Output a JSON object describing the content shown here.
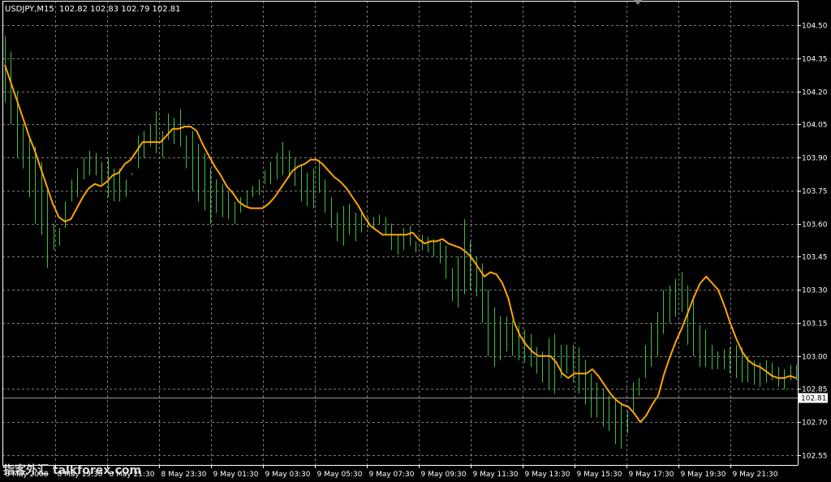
{
  "header": {
    "symbol": "USDJPY,M15",
    "ohlc": "102.82 102.83 102.79 102.81"
  },
  "colors": {
    "background": "#000000",
    "grid": "#7a7a7a",
    "bars": "#3fbf3f",
    "ma": "#ffa500",
    "axis_text": "#ffffff",
    "current_price_line": "#9a9a9a",
    "current_price_label_bg": "#ffffff"
  },
  "watermark": {
    "text": "指客外汇 talkforex.com"
  },
  "current_price": {
    "label": "102.81",
    "value": 102.81
  },
  "chart_data": {
    "type": "line",
    "title": "",
    "xlabel": "",
    "ylabel": "",
    "ylim": [
      102.47,
      104.58
    ],
    "grid": true,
    "y_ticks": [
      104.5,
      104.35,
      104.2,
      104.05,
      103.9,
      103.75,
      103.6,
      103.45,
      103.3,
      103.15,
      103.0,
      102.85,
      102.7,
      102.55
    ],
    "y_tick_labels": [
      "104.50",
      "104.35",
      "104.20",
      "104.05",
      "103.90",
      "103.75",
      "103.60",
      "103.45",
      "103.30",
      "103.15",
      "103.00",
      "102.85",
      "102.70",
      "102.55"
    ],
    "x_tick_labels": [
      "8 May 2008",
      "8 May 19:30",
      "8 May 21:30",
      "8 May 23:30",
      "9 May 01:30",
      "9 May 03:30",
      "9 May 05:30",
      "9 May 07:30",
      "9 May 09:30",
      "9 May 11:30",
      "9 May 13:30",
      "9 May 15:30",
      "9 May 17:30",
      "9 May 19:30",
      "9 May 21:30"
    ],
    "bars": {
      "name": "",
      "high": [
        104.45,
        104.38,
        104.2,
        104.05,
        104.0,
        103.95,
        103.88,
        103.75,
        103.6,
        103.58,
        103.7,
        103.8,
        103.85,
        103.9,
        103.93,
        103.92,
        103.88,
        103.9,
        103.85,
        103.85,
        103.8,
        103.83,
        104.0,
        104.02,
        104.05,
        104.11,
        104.02,
        104.1,
        104.08,
        104.12,
        104.0,
        104.02,
        103.96,
        103.92,
        103.85,
        103.8,
        103.78,
        103.75,
        103.7,
        103.72,
        103.75,
        103.77,
        103.8,
        103.84,
        103.88,
        103.92,
        103.97,
        103.93,
        103.9,
        103.87,
        103.83,
        103.85,
        103.89,
        103.8,
        103.72,
        103.65,
        103.68,
        103.69,
        103.65,
        103.65,
        103.63,
        103.63,
        103.64,
        103.63,
        103.6,
        103.55,
        103.58,
        103.59,
        103.52,
        103.55,
        103.54,
        103.53,
        103.52,
        103.5,
        103.4,
        103.45,
        103.62,
        103.52,
        103.45,
        103.42,
        103.3,
        103.22,
        103.18,
        103.18,
        103.16,
        103.14,
        103.12,
        103.1,
        103.04,
        103.02,
        103.08,
        103.1,
        103.05,
        103.05,
        103.05,
        103.04,
        102.98,
        102.92,
        102.88,
        102.85,
        102.82,
        102.8,
        102.78,
        102.75,
        102.88,
        102.9,
        103.05,
        103.15,
        103.2,
        103.3,
        103.32,
        103.35,
        103.38,
        103.32,
        103.25,
        103.14,
        103.12,
        103.05,
        103.02,
        103.03,
        103.04,
        103.05,
        103.04,
        103.0,
        102.98,
        102.97,
        102.98,
        102.97,
        102.95,
        102.94,
        102.96,
        102.96
      ],
      "low": [
        104.15,
        104.05,
        103.9,
        103.85,
        103.72,
        103.6,
        103.55,
        103.4,
        103.48,
        103.5,
        103.58,
        103.7,
        103.72,
        103.8,
        103.82,
        103.82,
        103.78,
        103.72,
        103.7,
        103.7,
        103.72,
        103.82,
        103.85,
        103.9,
        103.95,
        103.92,
        103.9,
        103.98,
        103.96,
        103.95,
        103.85,
        103.75,
        103.7,
        103.66,
        103.6,
        103.65,
        103.63,
        103.62,
        103.6,
        103.65,
        103.68,
        103.72,
        103.73,
        103.78,
        103.78,
        103.8,
        103.82,
        103.81,
        103.77,
        103.7,
        103.68,
        103.67,
        103.74,
        103.65,
        103.58,
        103.52,
        103.5,
        103.55,
        103.52,
        103.56,
        103.58,
        103.58,
        103.6,
        103.55,
        103.48,
        103.46,
        103.48,
        103.5,
        103.47,
        103.48,
        103.47,
        103.45,
        103.42,
        103.35,
        103.25,
        103.22,
        103.28,
        103.3,
        103.27,
        103.15,
        103.0,
        102.95,
        102.98,
        103.02,
        103.0,
        102.98,
        102.97,
        102.95,
        102.92,
        102.88,
        102.85,
        102.83,
        102.9,
        102.92,
        102.88,
        102.83,
        102.78,
        102.72,
        102.72,
        102.68,
        102.66,
        102.6,
        102.58,
        102.65,
        102.75,
        102.82,
        102.9,
        102.95,
        103.0,
        103.1,
        103.15,
        103.18,
        103.2,
        103.05,
        103.0,
        102.95,
        102.95,
        102.94,
        102.94,
        102.94,
        102.92,
        102.9,
        102.88,
        102.88,
        102.87,
        102.86,
        102.88,
        102.89,
        102.86,
        102.85,
        102.89,
        102.89
      ]
    },
    "series": [
      {
        "name": "",
        "values": [
          104.32,
          104.24,
          104.16,
          104.08,
          104.0,
          103.93,
          103.85,
          103.77,
          103.69,
          103.63,
          103.61,
          103.62,
          103.67,
          103.72,
          103.76,
          103.78,
          103.77,
          103.79,
          103.82,
          103.83,
          103.87,
          103.89,
          103.93,
          103.97,
          103.97,
          103.97,
          103.97,
          104.0,
          104.03,
          104.03,
          104.04,
          104.04,
          104.02,
          103.96,
          103.91,
          103.86,
          103.82,
          103.77,
          103.74,
          103.7,
          103.68,
          103.67,
          103.67,
          103.67,
          103.69,
          103.72,
          103.76,
          103.8,
          103.84,
          103.86,
          103.87,
          103.89,
          103.89,
          103.87,
          103.84,
          103.81,
          103.79,
          103.76,
          103.72,
          103.68,
          103.63,
          103.59,
          103.57,
          103.55,
          103.55,
          103.55,
          103.55,
          103.55,
          103.56,
          103.53,
          103.51,
          103.52,
          103.52,
          103.53,
          103.51,
          103.5,
          103.49,
          103.47,
          103.44,
          103.4,
          103.36,
          103.38,
          103.37,
          103.33,
          103.26,
          103.15,
          103.09,
          103.05,
          103.02,
          103.0,
          103.0,
          103.0,
          102.97,
          102.92,
          102.9,
          102.92,
          102.92,
          102.92,
          102.94,
          102.91,
          102.87,
          102.83,
          102.8,
          102.78,
          102.77,
          102.74,
          102.7,
          102.73,
          102.78,
          102.82,
          102.92,
          103.0,
          103.07,
          103.13,
          103.2,
          103.27,
          103.33,
          103.36,
          103.33,
          103.3,
          103.23,
          103.15,
          103.08,
          103.02,
          102.98,
          102.96,
          102.95,
          102.93,
          102.91,
          102.9,
          102.9,
          102.91,
          102.9
        ]
      }
    ]
  }
}
